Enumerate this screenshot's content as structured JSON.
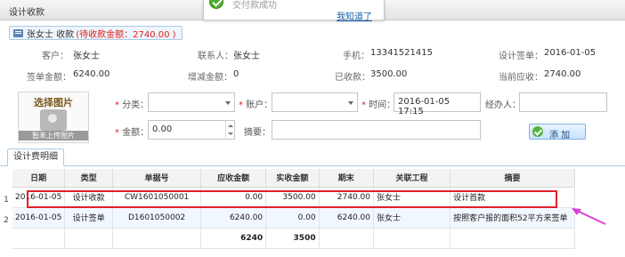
{
  "window": {
    "title": "设计收款"
  },
  "toast": {
    "message": "交付款成功",
    "confirm": "我知道了"
  },
  "header": {
    "customer_line": "张女士 收款",
    "pending": "(待收款金额：2740.00 )"
  },
  "info": {
    "customer_label": "客户：",
    "customer": "张女士",
    "contact_label": "联系人：",
    "contact": "张女士",
    "phone_label": "手机：",
    "phone": "13341521415",
    "design_sign_label": "设计签单：",
    "design_sign": "2016-01-05",
    "sign_amount_label": "签单金额：",
    "sign_amount": "6240.00",
    "adjust_label": "增减金额：",
    "adjust": "0",
    "received_label": "已收款：",
    "received": "3500.00",
    "current_due_label": "当前应收：",
    "current_due": "2740.00"
  },
  "upload": {
    "title": "选择图片",
    "caption": "暂未上传图片"
  },
  "form": {
    "category_label": "分类：",
    "category_value": "",
    "account_label": "账户：",
    "account_value": "",
    "time_label": "时间：",
    "time_value": "2016-01-05 17:15",
    "handler_label": "经办人：",
    "handler_value": "",
    "amount_label": "金额：",
    "amount_value": "0.00",
    "summary_label": "摘要：",
    "summary_value": "",
    "add_button": "添 加"
  },
  "tabs": {
    "detail": "设计费明细"
  },
  "table": {
    "headers": [
      "日期",
      "类型",
      "单据号",
      "应收金额",
      "实收金额",
      "期末",
      "关联工程",
      "摘要"
    ],
    "rows": [
      {
        "num": "1",
        "date": "2016-01-05",
        "type": "设计收款",
        "doc": "CW1601050001",
        "due": "0.00",
        "received": "3500.00",
        "balance": "2740.00",
        "project": "张女士",
        "summary": "设计首款"
      },
      {
        "num": "2",
        "date": "2016-01-05",
        "type": "设计签单",
        "doc": "D1601050002",
        "due": "6240.00",
        "received": "0.00",
        "balance": "6240.00",
        "project": "张女士",
        "summary": "按照客户报的面积52平方来签单"
      }
    ],
    "totals": {
      "due": "6240",
      "received": "3500"
    }
  },
  "colors": {
    "highlight": "#e0202a",
    "arrow": "#d93fd9",
    "pending_text": "#e02020"
  }
}
